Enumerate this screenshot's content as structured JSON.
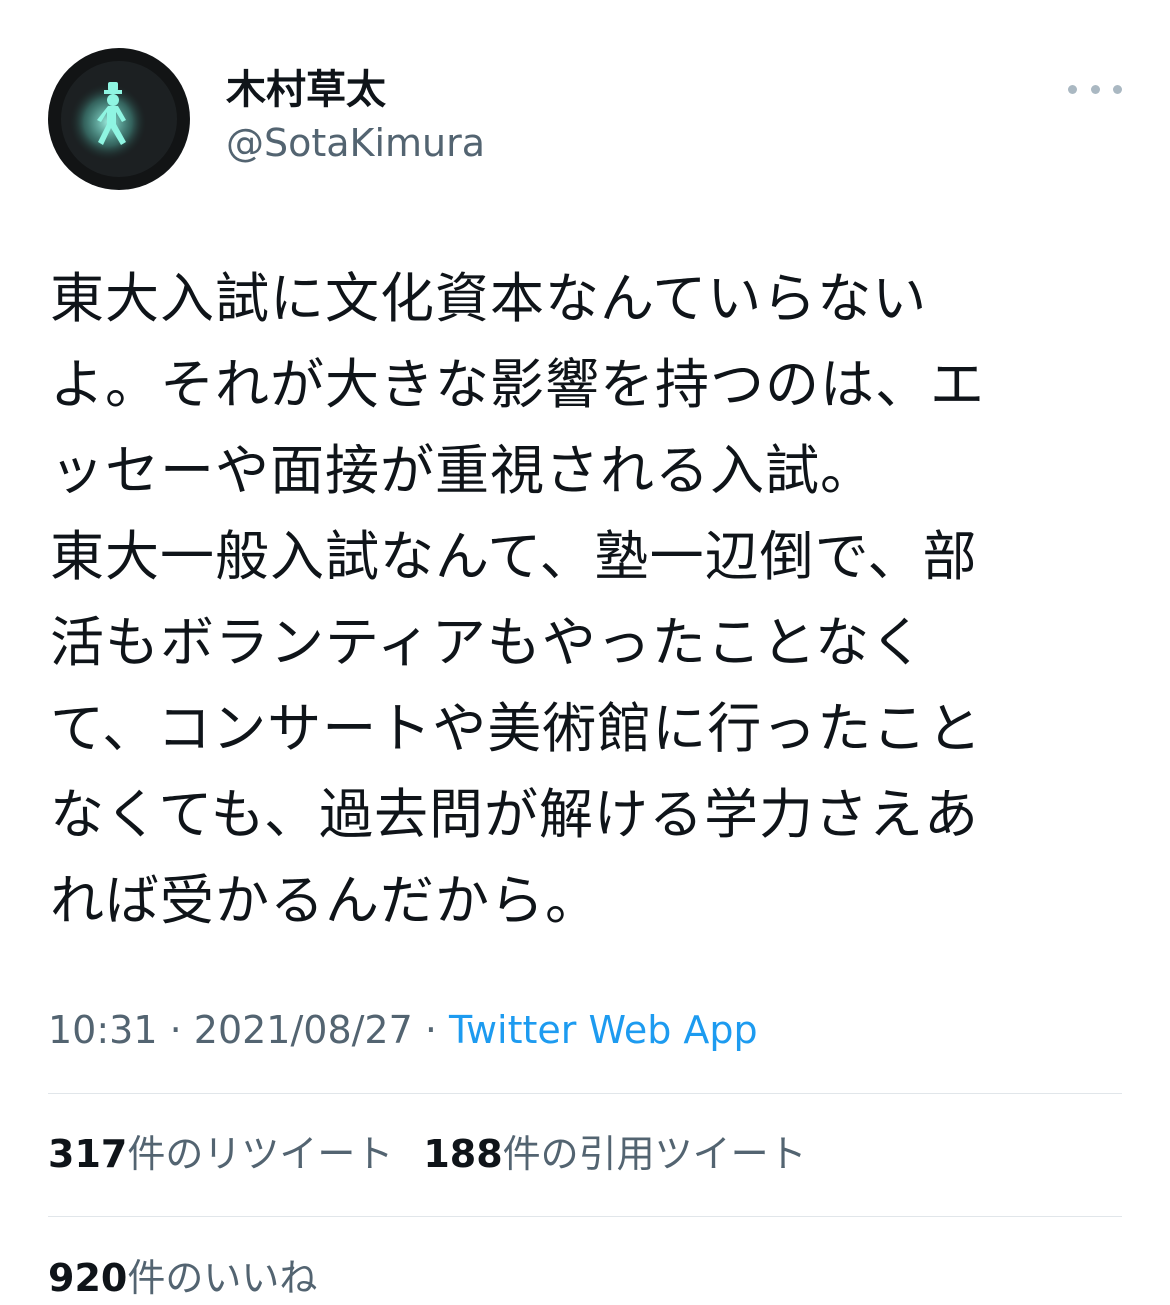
{
  "author": {
    "display_name": "木村草太",
    "handle": "@SotaKimura",
    "avatar_icon": "pedestrian-signal-icon"
  },
  "more_icon": "more-options-icon",
  "tweet": {
    "text_lines": [
      "東大入試に文化資本なんていらない",
      "よ。それが大きな影響を持つのは、エ",
      "ッセーや面接が重視される入試。",
      "東大一般入試なんて、塾一辺倒で、部",
      "活もボランティアもやったことなく",
      "て、コンサートや美術館に行ったこと",
      "なくても、過去問が解ける学力さえあ",
      "れば受かるんだから。"
    ]
  },
  "meta": {
    "time": "10:31",
    "sep1": " · ",
    "date": "2021/08/27",
    "sep2": " · ",
    "source": "Twitter Web App"
  },
  "stats": {
    "retweets_count": "317",
    "retweets_label": "件のリツイート",
    "quotes_count": "188",
    "quotes_label": "件の引用ツイート",
    "likes_count": "920",
    "likes_label": "件のいいね"
  },
  "colors": {
    "text": "#0f1419",
    "secondary": "#536471",
    "link": "#1d9bf0",
    "signal_green": "#7fe8d6"
  }
}
